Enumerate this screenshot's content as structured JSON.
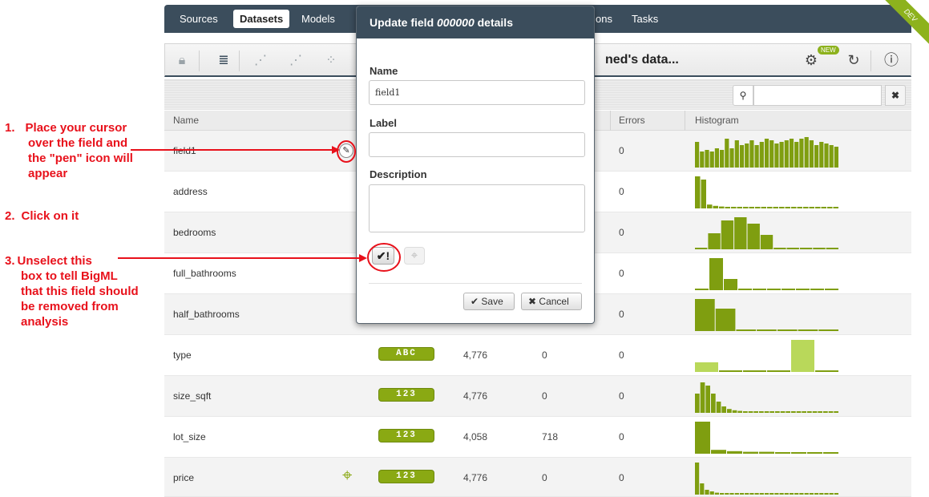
{
  "nav": {
    "tabs": [
      {
        "label": "Sources"
      },
      {
        "label": "Datasets"
      },
      {
        "label": "Models"
      },
      {
        "label": "ons"
      },
      {
        "label": "Tasks"
      }
    ],
    "ribbon": "DEV"
  },
  "toolbar": {
    "dataset_title": "ned's data...",
    "new_badge": "NEW",
    "icons": [
      "lock-icon",
      "dataset-icon",
      "model-icon",
      "ensemble-icon",
      "cluster-icon",
      "gear-icon",
      "sync-icon",
      "info-icon"
    ]
  },
  "search": {
    "placeholder": "",
    "clear_label": "✖"
  },
  "table": {
    "headers": {
      "name": "Name",
      "errors": "Errors",
      "histogram": "Histogram"
    },
    "rows": [
      {
        "name": "field1",
        "type": "",
        "count": "",
        "missing": "",
        "errors": "0"
      },
      {
        "name": "address",
        "type": "",
        "count": "",
        "missing": "",
        "errors": "0"
      },
      {
        "name": "bedrooms",
        "type": "",
        "count": "",
        "missing": "",
        "errors": "0"
      },
      {
        "name": "full_bathrooms",
        "type": "",
        "count": "",
        "missing": "",
        "errors": "0"
      },
      {
        "name": "half_bathrooms",
        "type": "",
        "count": "",
        "missing": "",
        "errors": "0"
      },
      {
        "name": "type",
        "type": "ABC",
        "count": "4,776",
        "missing": "0",
        "errors": "0"
      },
      {
        "name": "size_sqft",
        "type": "123",
        "count": "4,776",
        "missing": "0",
        "errors": "0"
      },
      {
        "name": "lot_size",
        "type": "123",
        "count": "4,058",
        "missing": "718",
        "errors": "0"
      },
      {
        "name": "price",
        "type": "123",
        "count": "4,776",
        "missing": "0",
        "errors": "0"
      }
    ]
  },
  "modal": {
    "title_prefix": "Update field ",
    "title_id": "000000",
    "title_suffix": " details",
    "name_label": "Name",
    "name_value": "field1",
    "label_label": "Label",
    "label_value": "",
    "description_label": "Description",
    "description_value": "",
    "preferred_toggle": "✔!",
    "save_label": "Save",
    "cancel_label": "Cancel"
  },
  "annotations": {
    "step1_num": "1.",
    "step1_lines": [
      "Place your cursor",
      "over the field and",
      "the \"pen\" icon will",
      "appear"
    ],
    "step2_num": "2.",
    "step2_text": "Click on it",
    "step3_num": "3.",
    "step3_lines": [
      "Unselect this",
      "box to tell BigML",
      "that this field should",
      "be removed from",
      "analysis"
    ]
  },
  "colors": {
    "accent": "#8aa913",
    "nav": "#3b4d5c",
    "annotation": "#e8111b"
  }
}
